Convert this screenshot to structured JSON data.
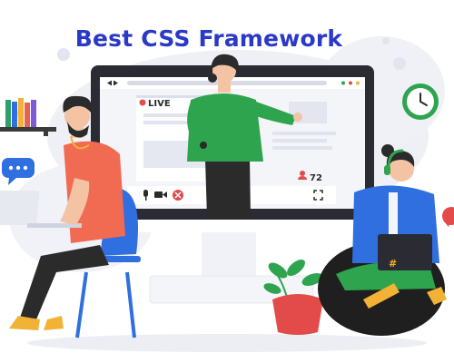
{
  "header": {
    "title": "Best CSS Framework"
  },
  "stream": {
    "live_label": "LIVE",
    "viewer_count": "72"
  },
  "laptop": {
    "glyph": "#"
  },
  "colors": {
    "title": "#2a39c7",
    "presenter_shirt": "#2ea44f",
    "viewer_shirt": "#f16a52",
    "student_sweater": "#2f6fe0",
    "beanbag": "#1f1f1f",
    "live_dot": "#e34b4b",
    "chair": "#2f6fe0"
  },
  "icons": [
    "video-camera-icon",
    "microphone-icon",
    "end-call-icon",
    "fullscreen-icon",
    "user-icon",
    "clock-icon",
    "chat-bubble-icon",
    "books-icon",
    "plant-icon",
    "laptop-icon",
    "headset-icon"
  ]
}
